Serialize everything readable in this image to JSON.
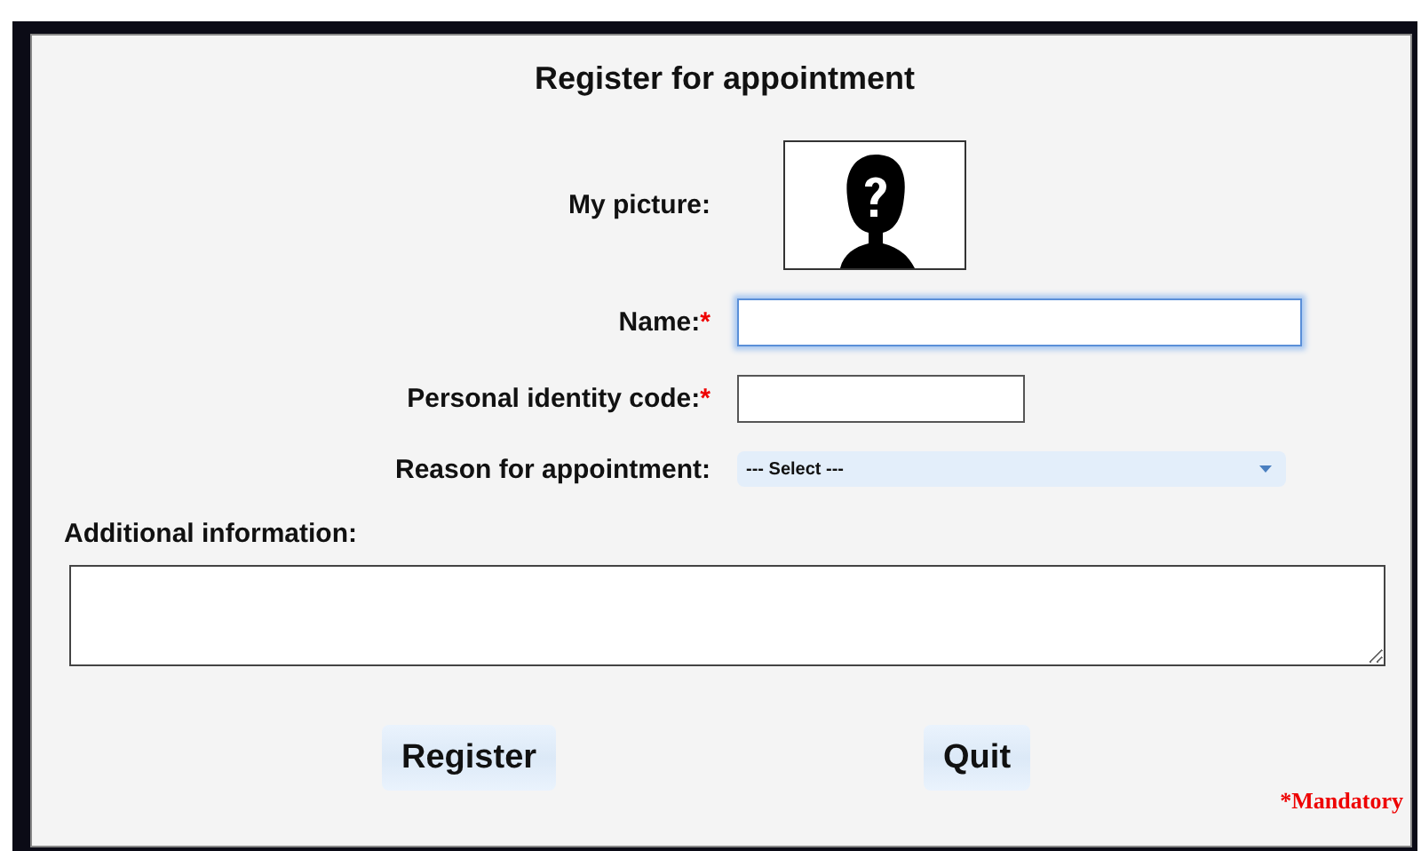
{
  "title": "Register for appointment",
  "picture_field": {
    "label": "My picture:"
  },
  "fields": [
    {
      "kind": "text",
      "label": "Name:",
      "mandatory": true,
      "focused": true,
      "wide": true
    },
    {
      "kind": "text",
      "label": "Personal identity code:",
      "mandatory": true,
      "focused": false,
      "wide": false
    },
    {
      "kind": "select",
      "label": "Reason for appointment:",
      "mandatory": false,
      "value": "--- Select ---"
    }
  ],
  "mandatory_mark": "*",
  "additional": {
    "label": "Additional information:"
  },
  "buttons": [
    "Register",
    "Quit"
  ],
  "mandatory_note": "*Mandatory"
}
